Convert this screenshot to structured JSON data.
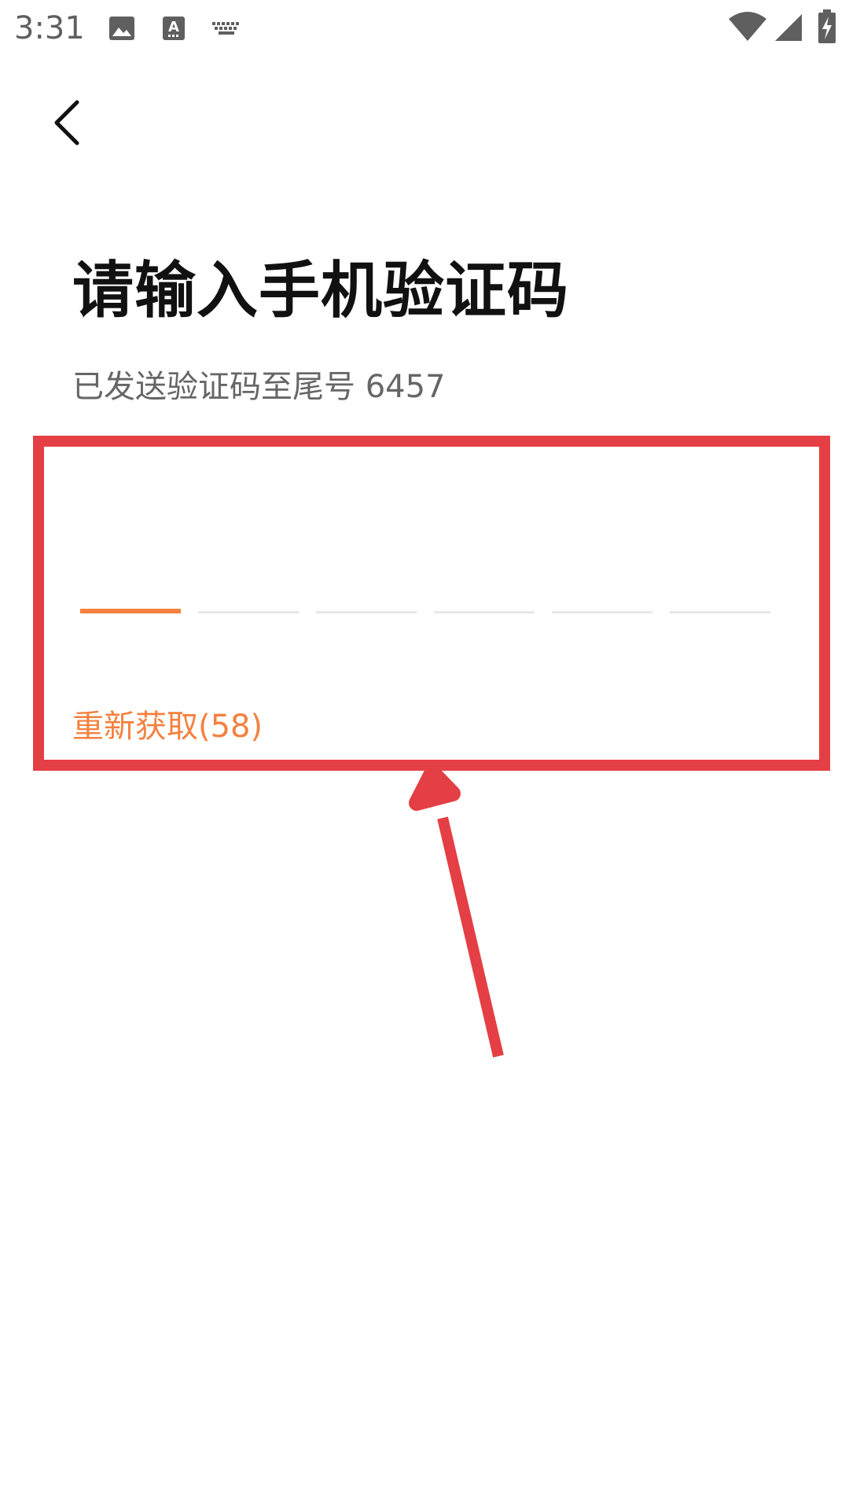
{
  "status_bar": {
    "time": "3:31",
    "left_icons": [
      "image-icon",
      "text-input-icon",
      "keyboard-icon"
    ],
    "right_icons": [
      "wifi-icon",
      "cell-signal-icon",
      "battery-charging-icon"
    ]
  },
  "nav": {
    "back_icon": "chevron-left-icon"
  },
  "verify": {
    "title": "请输入手机验证码",
    "subtitle": "已发送验证码至尾号 6457",
    "code_length": 6,
    "active_index": 0,
    "code_digits": [
      "",
      "",
      "",
      "",
      "",
      ""
    ],
    "resend_label": "重新获取(58)"
  },
  "colors": {
    "accent": "#f4813f",
    "title_text": "#111111",
    "subtitle_text": "#666666",
    "inactive_underline": "#e8e8e8",
    "annotation": "#e43f44",
    "status_icons": "#5f5f5f"
  }
}
